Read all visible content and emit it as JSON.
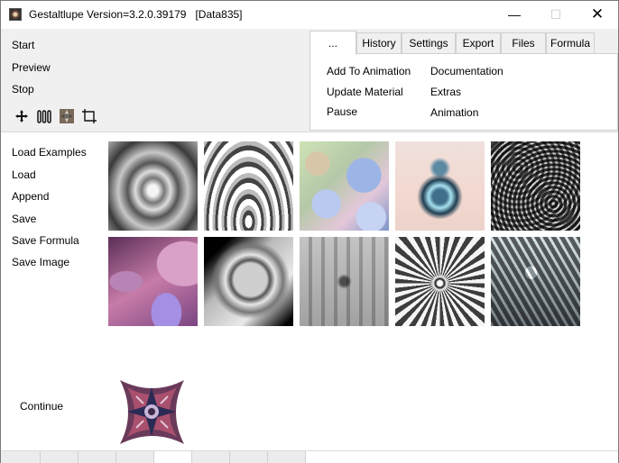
{
  "window": {
    "title": "Gestaltlupe Version=3.2.0.39179   [Data835]",
    "minimize_symbol": "—",
    "maximize_symbol": "☐",
    "close_symbol": "✕"
  },
  "commands": {
    "start": "Start",
    "preview": "Preview",
    "stop": "Stop"
  },
  "toolbar_icons": [
    "move-icon",
    "pillars-icon",
    "fractal-icon",
    "crop-icon"
  ],
  "tabs": [
    {
      "label": "...",
      "active": true
    },
    {
      "label": "History",
      "active": false
    },
    {
      "label": "Settings",
      "active": false
    },
    {
      "label": "Export",
      "active": false
    },
    {
      "label": "Files",
      "active": false
    },
    {
      "label": "Formula",
      "active": false
    }
  ],
  "tab_panel": {
    "add_to_animation": "Add To Animation",
    "update_material": "Update Material",
    "pause": "Pause",
    "documentation": "Documentation",
    "extras": "Extras",
    "animation": "Animation"
  },
  "side_menu": {
    "load_examples": "Load Examples",
    "load": "Load",
    "append": "Append",
    "save": "Save",
    "save_formula": "Save Formula",
    "save_image": "Save Image"
  },
  "gallery": {
    "thumbnails": [
      "fractal-thumbnail-1",
      "fractal-thumbnail-2",
      "fractal-thumbnail-3",
      "fractal-thumbnail-4",
      "fractal-thumbnail-5",
      "fractal-thumbnail-6",
      "fractal-thumbnail-7",
      "fractal-thumbnail-8",
      "fractal-thumbnail-9",
      "fractal-thumbnail-10"
    ]
  },
  "continue_label": "Continue",
  "status_segments": 9
}
